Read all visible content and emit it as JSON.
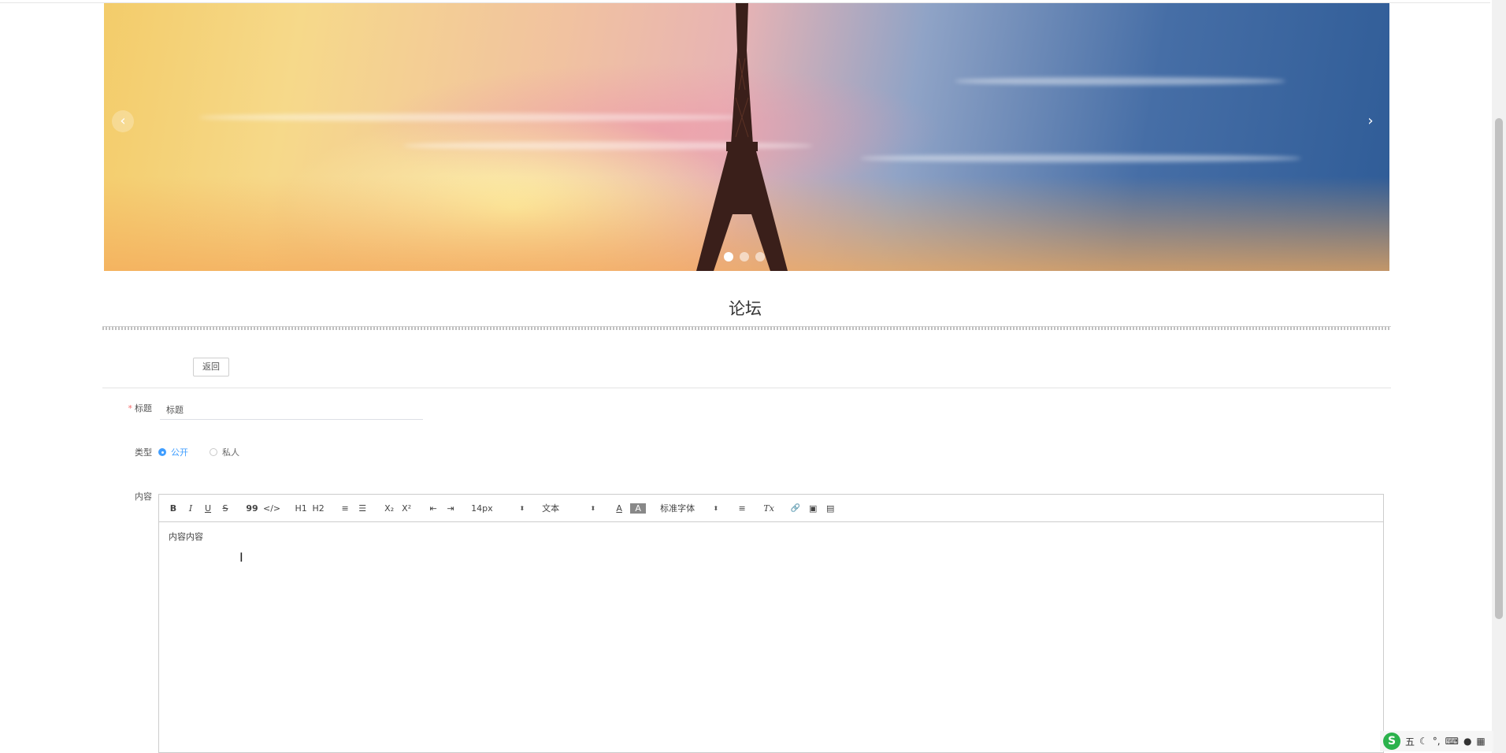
{
  "banner": {
    "prev_arrow": "‹",
    "next_arrow": "›",
    "slide_count": 3,
    "active_slide": 1
  },
  "page": {
    "title": "论坛"
  },
  "actions": {
    "back_label": "返回"
  },
  "form": {
    "title_field": {
      "label": "标题",
      "required": true,
      "value": "标题"
    },
    "type_field": {
      "label": "类型",
      "options": [
        {
          "label": "公开",
          "checked": true
        },
        {
          "label": "私人",
          "checked": false
        }
      ]
    },
    "content_field": {
      "label": "内容",
      "value": "内容内容",
      "toolbar": {
        "bold": "B",
        "italic": "I",
        "underline": "U",
        "strike": "S",
        "blockquote": "99",
        "code": "</>",
        "h1": "H1",
        "h2": "H2",
        "ordered_list": "≡",
        "bullet_list": "☰",
        "subscript": "X₂",
        "superscript": "X²",
        "outdent": "⇤",
        "indent": "⇥",
        "size": "14px",
        "header": "文本",
        "font": "标准字体",
        "color": "A",
        "background": "A",
        "align": "≡",
        "clean": "Tx",
        "link": "🔗",
        "image": "▣",
        "video": "▤"
      }
    }
  },
  "ime": {
    "logo": "S",
    "mode": "五"
  },
  "colors": {
    "accent": "#409eff",
    "required": "#f56c6c",
    "ime": "#2bb24c"
  }
}
